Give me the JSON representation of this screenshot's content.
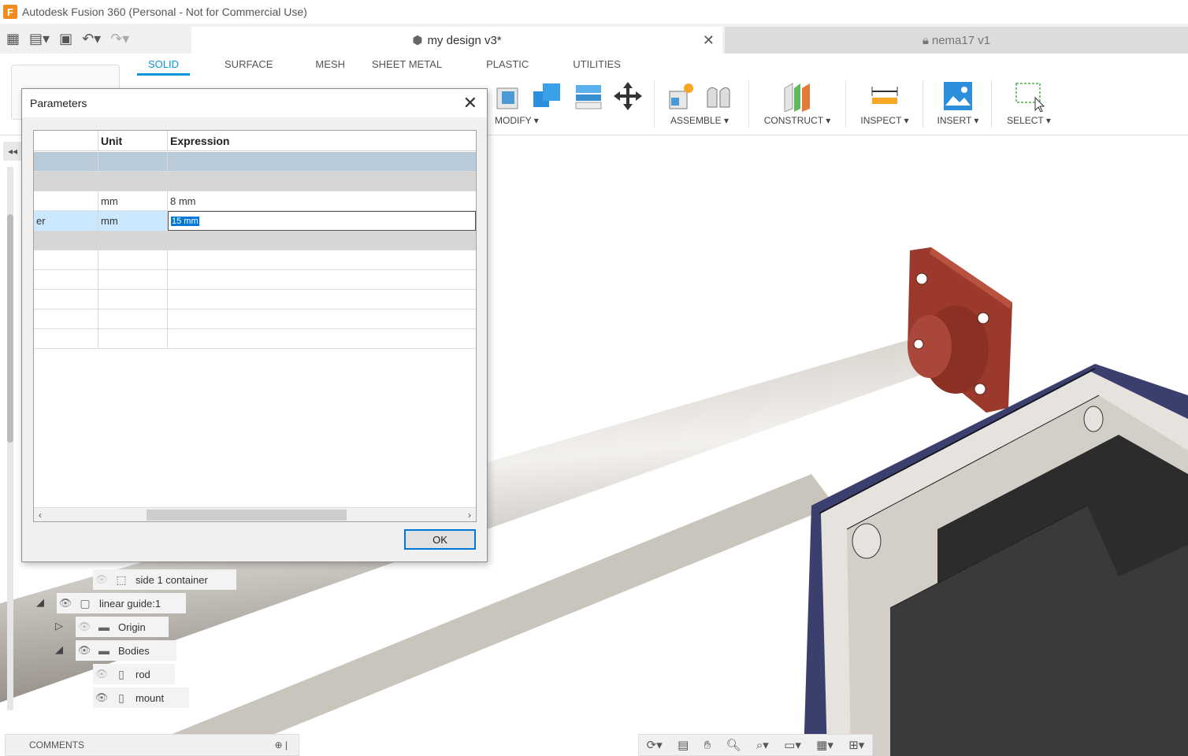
{
  "window": {
    "title": "Autodesk Fusion 360 (Personal - Not for Commercial Use)",
    "logo_letter": "F"
  },
  "qat": {
    "grid_icon": "apps-grid-icon",
    "file_icon": "file-icon",
    "save_icon": "save-icon",
    "undo_icon": "undo-icon",
    "redo_icon": "redo-icon"
  },
  "doc_tabs": [
    {
      "label": "my design v3*",
      "active": true
    },
    {
      "label": "nema17 v1",
      "active": false
    }
  ],
  "ribbon": {
    "tabs": [
      "SOLID",
      "SURFACE",
      "MESH",
      "SHEET METAL",
      "PLASTIC",
      "UTILITIES"
    ],
    "active_tab": "SOLID",
    "groups": [
      "MODIFY ▾",
      "ASSEMBLE ▾",
      "CONSTRUCT ▾",
      "INSPECT ▾",
      "INSERT ▾",
      "SELECT ▾"
    ]
  },
  "browser": {
    "items": [
      {
        "label": "side 1 container"
      },
      {
        "label": "linear guide:1"
      },
      {
        "label": "Origin"
      },
      {
        "label": "Bodies"
      },
      {
        "label": "rod"
      },
      {
        "label": "mount"
      }
    ]
  },
  "comments": {
    "label": "COMMENTS"
  },
  "dialog": {
    "title": "Parameters",
    "columns": [
      "",
      "Unit",
      "Expression"
    ],
    "rows": [
      {
        "name": "",
        "unit": "",
        "expr": ""
      },
      {
        "name": "",
        "unit": "",
        "expr": ""
      },
      {
        "name": "",
        "unit": "mm",
        "expr": "8 mm"
      },
      {
        "name": "er",
        "unit": "mm",
        "expr": "15 mm"
      }
    ],
    "ok_label": "OK"
  },
  "colors": {
    "accent": "#0696d7",
    "selection": "#0078d7",
    "mount_red": "#9b3a2c",
    "motor_frame": "#3b3f6e"
  }
}
